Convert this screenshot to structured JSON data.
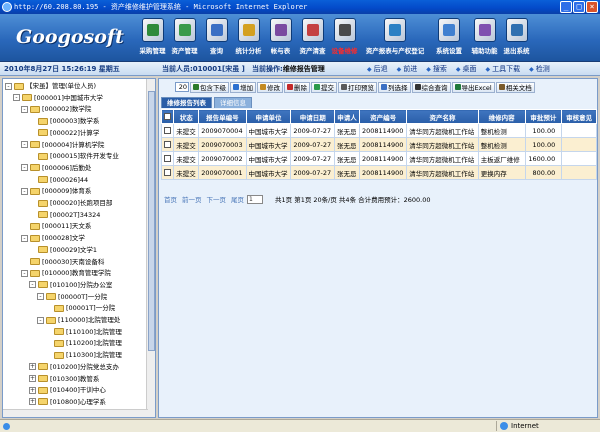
{
  "window": {
    "title": "http://60.208.80.195 - 资产维修维护管理系统 - Microsoft Internet Explorer",
    "min": "_",
    "max": "□",
    "close": "×"
  },
  "app": {
    "logo": "Googosoft",
    "nav": [
      {
        "label": "采购管理",
        "icon": "cart-icon",
        "color": "#2f8a3a"
      },
      {
        "label": "资产管理",
        "icon": "tree-icon",
        "color": "#3a9a4a"
      },
      {
        "label": "查询",
        "icon": "monitor-icon",
        "color": "#3a6fc4"
      },
      {
        "label": "统计分析",
        "icon": "pie-chart-icon",
        "color": "#d4a020"
      },
      {
        "label": "帐与表",
        "icon": "ledger-icon",
        "color": "#7a4aa0"
      },
      {
        "label": "资产清查",
        "icon": "bar-chart-icon",
        "color": "#c44040"
      },
      {
        "label": "设备维修",
        "icon": "magnifier-icon",
        "color": "#4a4a4a",
        "active": true
      },
      {
        "label": "资产报表与产权登记",
        "icon": "report-icon",
        "color": "#2a80c4",
        "size": "wide"
      },
      {
        "label": "系统设置",
        "icon": "settings-icon",
        "color": "#4080d0",
        "size": "mid"
      },
      {
        "label": "辅助功能",
        "icon": "tools-icon",
        "color": "#8050b0"
      },
      {
        "label": "退出系统",
        "icon": "exit-icon",
        "color": "#3070b0"
      }
    ]
  },
  "status": {
    "date": "2010年8月27日 15:26:19 星期五",
    "user": "当前人员:010001[宋虽 ]",
    "op_label": "当前操作:",
    "op_value": "维修报告管理",
    "links": [
      "后退",
      "前进",
      "搜索",
      "桌面",
      "工具下载",
      "检测"
    ]
  },
  "tree": {
    "nodes": [
      {
        "label": "【宋虽】管理(单位人员)",
        "level": 0,
        "pm": "-"
      },
      {
        "label": "[000001]中国城市大学",
        "level": 1,
        "pm": "-"
      },
      {
        "label": "[000002]数学院",
        "level": 2,
        "pm": "-"
      },
      {
        "label": "[000003]数学系",
        "level": 3,
        "pm": ""
      },
      {
        "label": "[000022]计算学",
        "level": 3,
        "pm": ""
      },
      {
        "label": "[000004]计算机学院",
        "level": 2,
        "pm": "-"
      },
      {
        "label": "[000015]软件开发专业",
        "level": 3,
        "pm": ""
      },
      {
        "label": "[000006]后勤处",
        "level": 2,
        "pm": "-"
      },
      {
        "label": "[000026]44",
        "level": 3,
        "pm": ""
      },
      {
        "label": "[000009]体育系",
        "level": 2,
        "pm": "-"
      },
      {
        "label": "[000020]长跑项目部",
        "level": 3,
        "pm": ""
      },
      {
        "label": "[00002T]34324",
        "level": 3,
        "pm": ""
      },
      {
        "label": "[000011]天文系",
        "level": 2,
        "pm": ""
      },
      {
        "label": "[000028]文学",
        "level": 2,
        "pm": "-"
      },
      {
        "label": "[000029]文学1",
        "level": 3,
        "pm": ""
      },
      {
        "label": "[000030]天南设备科",
        "level": 2,
        "pm": ""
      },
      {
        "label": "[010000]教育管理学院",
        "level": 2,
        "pm": "-"
      },
      {
        "label": "[010100]分院办公室",
        "level": 3,
        "pm": "-"
      },
      {
        "label": "[00000T]一分院",
        "level": 4,
        "pm": "-"
      },
      {
        "label": "[00001T]一分院",
        "level": 5,
        "pm": ""
      },
      {
        "label": "[110000]北院管理处",
        "level": 4,
        "pm": "-"
      },
      {
        "label": "[110100]北院管理",
        "level": 5,
        "pm": ""
      },
      {
        "label": "[110200]北院管理",
        "level": 5,
        "pm": ""
      },
      {
        "label": "[110300]北院管理",
        "level": 5,
        "pm": ""
      },
      {
        "label": "[010200]分院党总支办",
        "level": 3,
        "pm": "+"
      },
      {
        "label": "[010300]教管系",
        "level": 3,
        "pm": "+"
      },
      {
        "label": "[010400]干训中心",
        "level": 3,
        "pm": "+"
      },
      {
        "label": "[010800]心理学系",
        "level": 3,
        "pm": "+"
      }
    ]
  },
  "toolbar": {
    "page_size": "20",
    "buttons": [
      {
        "label": "包含下级",
        "icon": "checkbox-icon",
        "color": "#2a7a2a"
      },
      {
        "label": "增加",
        "icon": "add-icon",
        "color": "#2a6fd0"
      },
      {
        "label": "修改",
        "icon": "edit-icon",
        "color": "#c48a20"
      },
      {
        "label": "删除",
        "icon": "delete-icon",
        "color": "#c42a2a"
      },
      {
        "label": "提交",
        "icon": "submit-icon",
        "color": "#2a9a4a"
      },
      {
        "label": "打印预览",
        "icon": "print-icon",
        "color": "#5a5a5a"
      },
      {
        "label": "列选择",
        "icon": "columns-icon",
        "color": "#3a6fc4"
      },
      {
        "label": "综合查询",
        "icon": "binoculars-icon",
        "color": "#333333"
      },
      {
        "label": "导出Excel",
        "icon": "excel-icon",
        "color": "#1f7a3a"
      },
      {
        "label": "相关文档",
        "icon": "document-icon",
        "color": "#7a5a2a"
      }
    ]
  },
  "tabs": [
    {
      "label": "维修报告列表",
      "active": true
    },
    {
      "label": "详细信息",
      "active": false
    }
  ],
  "grid": {
    "headers": [
      "",
      "状态",
      "报告单编号",
      "申请单位",
      "申请日期",
      "申请人",
      "资产编号",
      "资产名称",
      "维修内容",
      "审批预计",
      "审核意见"
    ],
    "rows": [
      [
        "",
        "未提交",
        "2009070004",
        "中国城市大学",
        "2009-07-27",
        "张无忌",
        "2008114900",
        "清华同方超微机工作站",
        "整机检测",
        "100.00",
        ""
      ],
      [
        "",
        "未提交",
        "2009070003",
        "中国城市大学",
        "2009-07-27",
        "张无忌",
        "2008114900",
        "清华同方超微机工作站",
        "整机检测",
        "100.00",
        ""
      ],
      [
        "",
        "未提交",
        "2009070002",
        "中国城市大学",
        "2009-07-27",
        "张无忌",
        "2008114900",
        "清华同方超微机工作站",
        "主板返厂维修",
        "1600.00",
        ""
      ],
      [
        "",
        "未提交",
        "2009070001",
        "中国城市大学",
        "2009-07-27",
        "张无忌",
        "2008114900",
        "清华同方超微机工作站",
        "更换内存",
        "800.00",
        ""
      ]
    ]
  },
  "pager": {
    "links": [
      "首页",
      "前一页",
      "下一页",
      "尾页"
    ],
    "select": "1",
    "info": "共1页 第1页 20条/页 共4条 合计费用预计：2600.00"
  },
  "iestatus": {
    "zone": "Internet"
  }
}
